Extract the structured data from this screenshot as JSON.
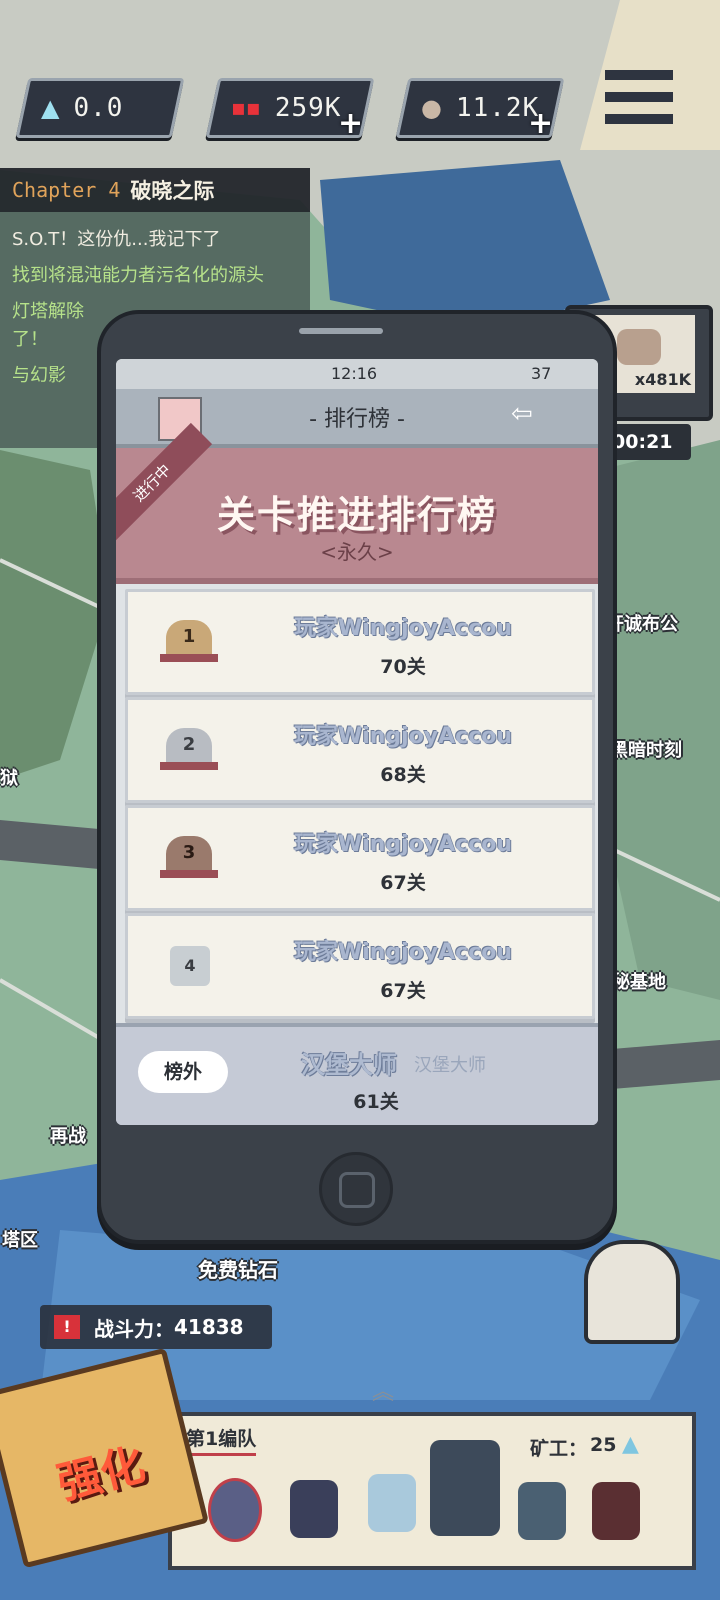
{
  "resources": [
    {
      "icon": "diamond-icon",
      "value": "0.0",
      "plus": false
    },
    {
      "icon": "ore-icon",
      "value": "259K",
      "plus": true
    },
    {
      "icon": "stone-icon",
      "value": "11.2K",
      "plus": true
    }
  ],
  "quest": {
    "chapter": "Chapter 4",
    "chapter_title": "破晓之际",
    "lines": [
      "S.O.T！这份仇...我记下了",
      "找到将混沌能力者污名化的源头",
      "灯塔解除了！",
      "与幻影"
    ]
  },
  "phone": {
    "time": "12:16",
    "battery": "37",
    "title": "- 排行榜 -",
    "ribbon": "进行中",
    "board_title": "关卡推进排行榜",
    "board_sub": "<永久>",
    "ranks": [
      {
        "rank": "1",
        "name": "玩家WingjoyAccou",
        "level": "70关"
      },
      {
        "rank": "2",
        "name": "玩家WingjoyAccou",
        "level": "68关"
      },
      {
        "rank": "3",
        "name": "玩家WingjoyAccou",
        "level": "67关"
      },
      {
        "rank": "4",
        "name": "玩家WingjoyAccou",
        "level": "67关"
      }
    ],
    "self": {
      "badge": "榜外",
      "name": "汉堡大师",
      "name_shadow": "汉堡大师",
      "level": "61关"
    }
  },
  "tv": {
    "count": "x481K",
    "timer": "00:21"
  },
  "map_labels": {
    "a": "开诚布公",
    "b": "黑暗时刻",
    "c": "秘基地",
    "d": "狱",
    "e": "再战",
    "f": "塔区",
    "g": "免费钻石"
  },
  "power": {
    "label": "战斗力：",
    "value": "41838"
  },
  "team": {
    "name": "第1编队",
    "miners_label": "矿工：",
    "miners": "25"
  },
  "upgrade_label": "强化"
}
